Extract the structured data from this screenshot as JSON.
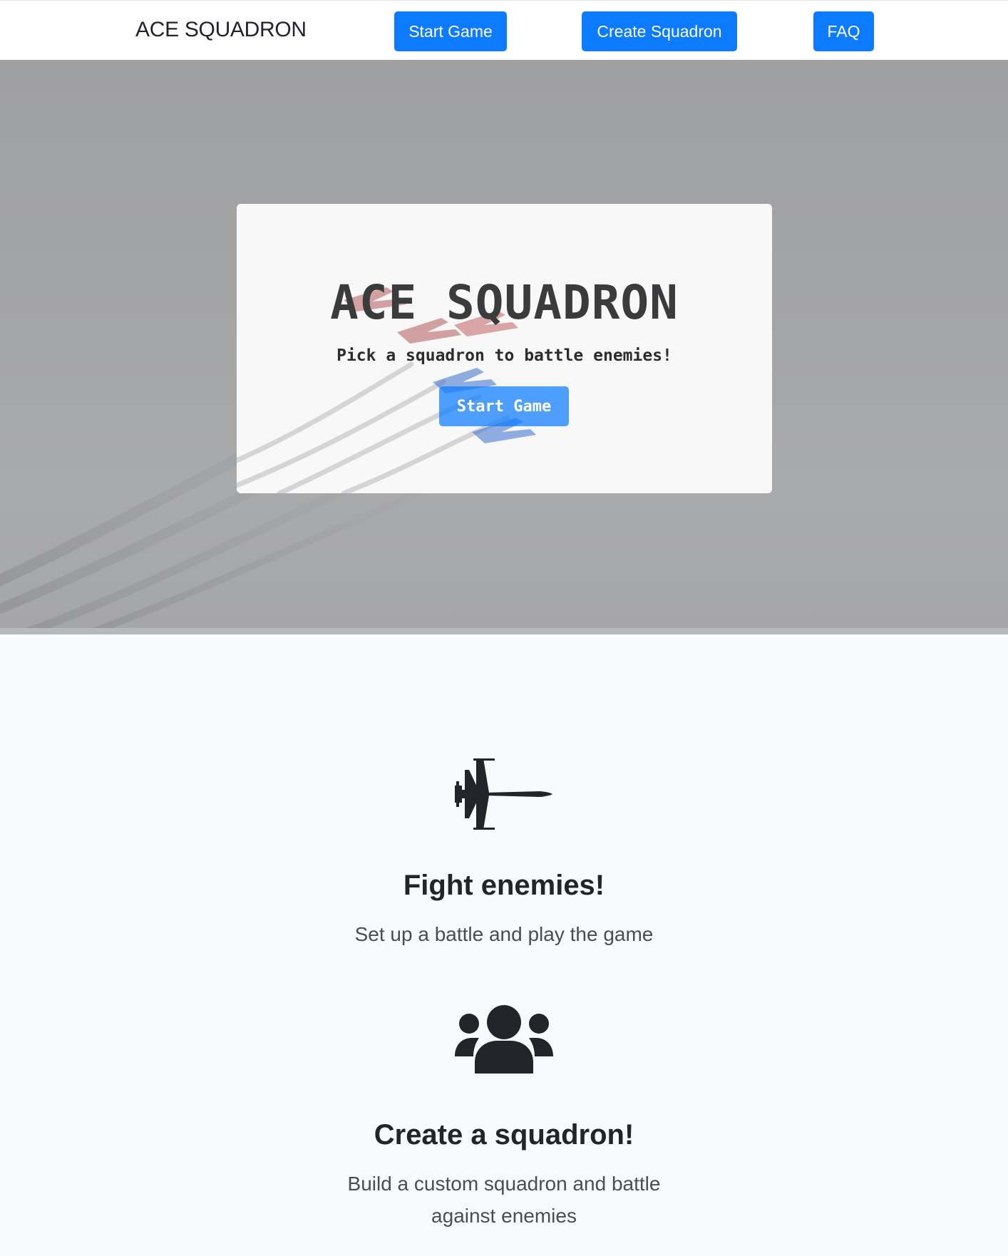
{
  "navbar": {
    "brand": "ACE SQUADRON",
    "links": [
      {
        "label": "Start Game"
      },
      {
        "label": "Create Squadron"
      },
      {
        "label": "FAQ"
      }
    ],
    "accent": "#0d7bff"
  },
  "hero": {
    "title": "ACE SQUADRON",
    "subtitle": "Pick a squadron to battle enemies!",
    "cta_label": "Start Game"
  },
  "features": [
    {
      "icon": "fighter-jet-icon",
      "title": "Fight enemies!",
      "text": "Set up a battle and play the game"
    },
    {
      "icon": "users-icon",
      "title": "Create a squadron!",
      "text": "Build a custom squadron and battle against enemies"
    }
  ]
}
